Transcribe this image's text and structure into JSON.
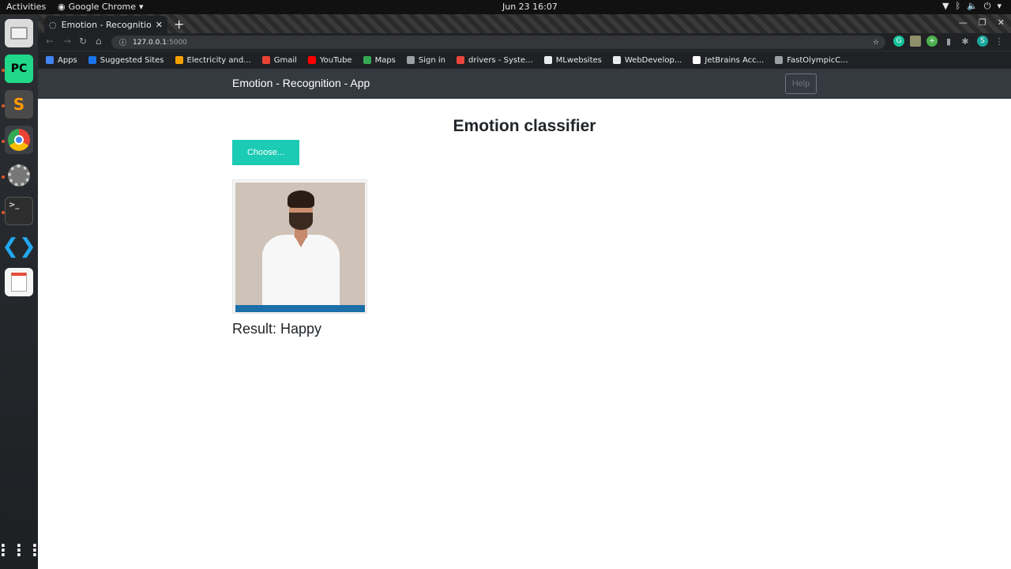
{
  "os": {
    "activities": "Activities",
    "app_menu": "Google Chrome",
    "clock": "Jun 23  16:07"
  },
  "browser": {
    "tab_title": "Emotion - Recognition - A",
    "url_host": "127.0.0.1",
    "url_port": ":5000",
    "bookmarks": [
      {
        "label": "Apps",
        "color": "#4285f4"
      },
      {
        "label": "Suggested Sites",
        "color": "#1a73e8"
      },
      {
        "label": "Electricity and...",
        "color": "#f4a100"
      },
      {
        "label": "Gmail",
        "color": "#ea4335"
      },
      {
        "label": "YouTube",
        "color": "#ff0000"
      },
      {
        "label": "Maps",
        "color": "#34a853"
      },
      {
        "label": "Sign in",
        "color": "#9aa0a6"
      },
      {
        "label": "drivers - Syste...",
        "color": "#e8453c"
      },
      {
        "label": "MLwebsites",
        "color": "#e8eaed"
      },
      {
        "label": "WebDevelop...",
        "color": "#e8eaed"
      },
      {
        "label": "JetBrains Acc...",
        "color": "#ffffff"
      },
      {
        "label": "FastOlympicC...",
        "color": "#9aa0a6"
      }
    ]
  },
  "app": {
    "brand": "Emotion - Recognition - App",
    "help_label": "Help",
    "heading": "Emotion classifier",
    "choose_label": "Choose...",
    "result_text": "Result: Happy",
    "accent_color": "#1ccbb3",
    "navbar_color": "#343a40"
  }
}
